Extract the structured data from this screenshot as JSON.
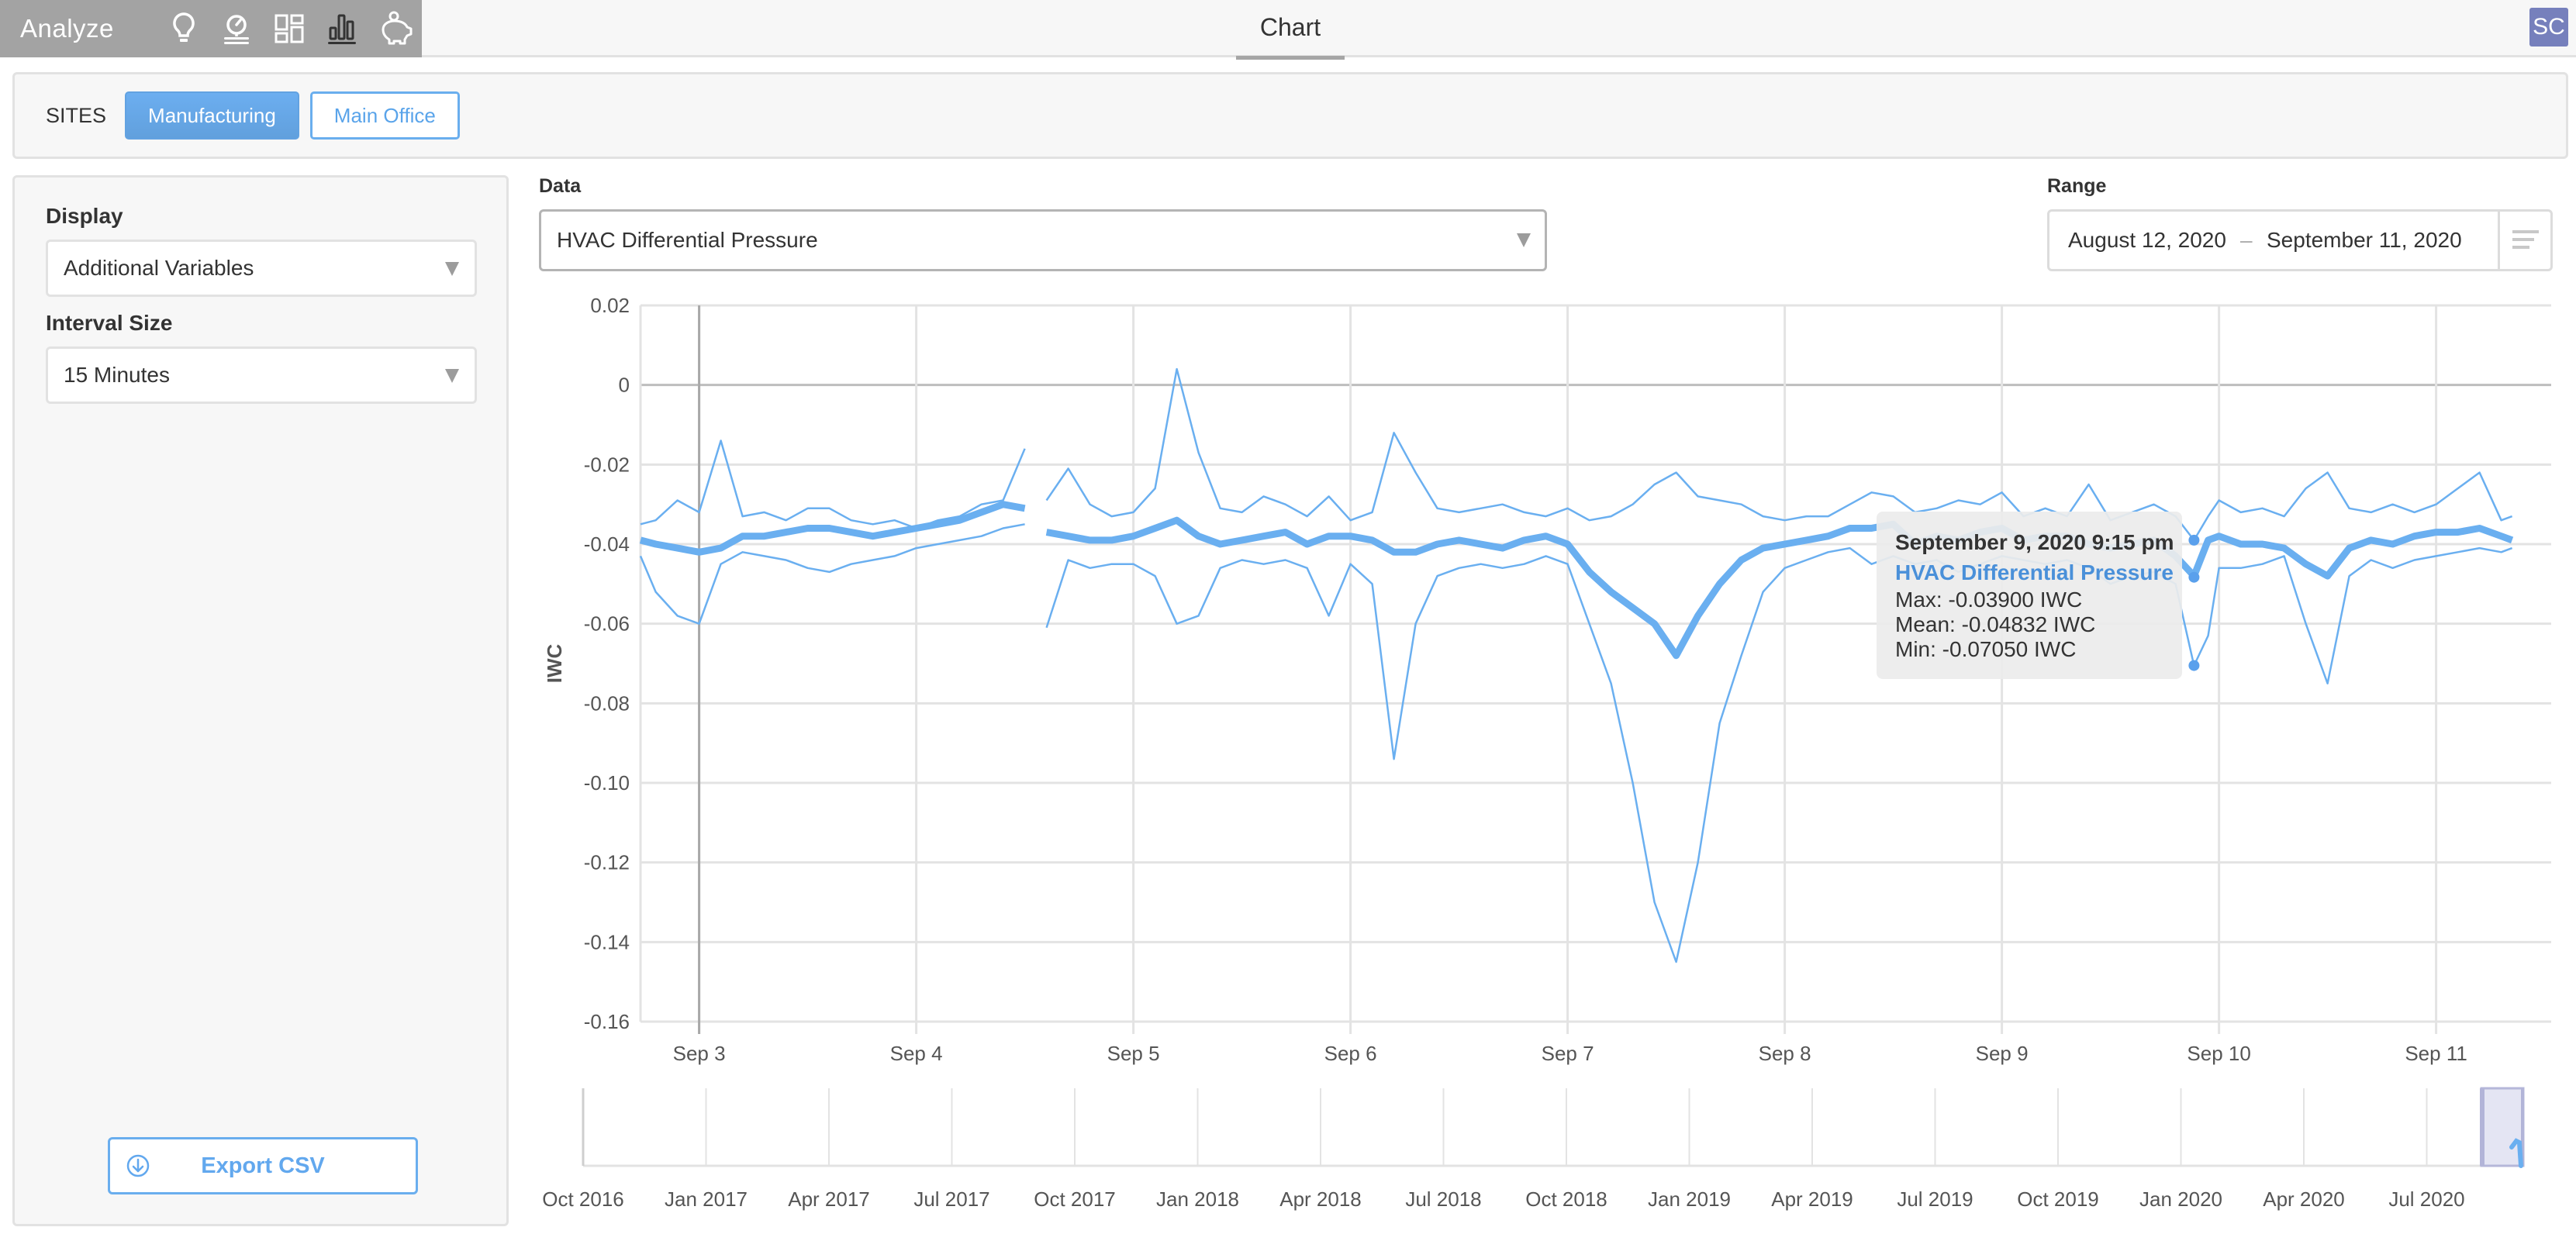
{
  "app": {
    "title": "Analyze",
    "nav_icons": [
      "lightbulb-icon",
      "gauge-icon",
      "dashboard-grid-icon",
      "bar-chart-icon",
      "piggy-bank-icon"
    ],
    "active_nav": "bar-chart-icon",
    "tab": "Chart",
    "user_initials": "SC"
  },
  "sites": {
    "label": "SITES",
    "items": [
      {
        "label": "Manufacturing",
        "active": true
      },
      {
        "label": "Main Office",
        "active": false
      }
    ]
  },
  "sidebar": {
    "display_label": "Display",
    "display_value": "Additional Variables",
    "interval_label": "Interval Size",
    "interval_value": "15 Minutes",
    "export_label": "Export CSV"
  },
  "controls": {
    "data_label": "Data",
    "data_value": "HVAC Differential Pressure",
    "range_label": "Range",
    "range_start": "August 12, 2020",
    "range_separator": "–",
    "range_end": "September 11, 2020"
  },
  "tooltip": {
    "date": "September 9, 2020 9:15 pm",
    "series": "HVAC Differential Pressure",
    "max": "Max: -0.03900 IWC",
    "mean": "Mean: -0.04832 IWC",
    "min": "Min: -0.07050 IWC"
  },
  "colors": {
    "accent": "#62a8ee",
    "series": "#6aaff0",
    "avatar": "#7680bc",
    "navigator_window": "#e4e5f3"
  },
  "chart_data": {
    "type": "line",
    "title": "",
    "ylabel": "IWC",
    "xlabel": "",
    "ylim": [
      -0.16,
      0.02
    ],
    "yticks": [
      "0.02",
      "0",
      "-0.02",
      "-0.04",
      "-0.06",
      "-0.08",
      "-0.10",
      "-0.12",
      "-0.14",
      "-0.16"
    ],
    "xticks": [
      "Sep 3",
      "Sep 4",
      "Sep 5",
      "Sep 6",
      "Sep 7",
      "Sep 8",
      "Sep 9",
      "Sep 10",
      "Sep 11"
    ],
    "x_unit": "days since Sep 3 00:00 (2020)",
    "xlim": [
      -0.27,
      8.53
    ],
    "crosshair_x": 0.0,
    "hover_x": 6.885,
    "hover_values": {
      "max": -0.039,
      "mean": -0.04832,
      "min": -0.0705
    },
    "x": [
      -0.27,
      -0.2,
      -0.1,
      0.0,
      0.1,
      0.2,
      0.3,
      0.4,
      0.5,
      0.6,
      0.7,
      0.8,
      0.9,
      1.0,
      1.1,
      1.2,
      1.3,
      1.4,
      1.5,
      1.55,
      1.6,
      1.7,
      1.8,
      1.9,
      2.0,
      2.1,
      2.2,
      2.3,
      2.4,
      2.5,
      2.6,
      2.7,
      2.8,
      2.9,
      3.0,
      3.1,
      3.2,
      3.3,
      3.4,
      3.5,
      3.6,
      3.7,
      3.8,
      3.9,
      4.0,
      4.1,
      4.2,
      4.3,
      4.4,
      4.5,
      4.6,
      4.7,
      4.8,
      4.9,
      5.0,
      5.1,
      5.2,
      5.3,
      5.4,
      5.5,
      5.6,
      5.7,
      5.8,
      5.9,
      6.0,
      6.1,
      6.2,
      6.3,
      6.4,
      6.5,
      6.6,
      6.7,
      6.8,
      6.885,
      6.95,
      7.0,
      7.1,
      7.2,
      7.3,
      7.4,
      7.5,
      7.6,
      7.7,
      7.8,
      7.9,
      8.0,
      8.1,
      8.2,
      8.3,
      8.35
    ],
    "series": [
      {
        "name": "Max",
        "values": [
          -0.035,
          -0.034,
          -0.029,
          -0.032,
          -0.014,
          -0.033,
          -0.032,
          -0.034,
          -0.031,
          -0.031,
          -0.034,
          -0.035,
          -0.034,
          -0.036,
          -0.034,
          -0.033,
          -0.03,
          -0.029,
          -0.016,
          null,
          -0.029,
          -0.021,
          -0.03,
          -0.033,
          -0.032,
          -0.026,
          0.004,
          -0.017,
          -0.031,
          -0.032,
          -0.028,
          -0.03,
          -0.033,
          -0.028,
          -0.034,
          -0.032,
          -0.012,
          -0.022,
          -0.031,
          -0.032,
          -0.031,
          -0.03,
          -0.032,
          -0.033,
          -0.031,
          -0.034,
          -0.033,
          -0.03,
          -0.025,
          -0.022,
          -0.028,
          -0.029,
          -0.03,
          -0.033,
          -0.034,
          -0.033,
          -0.033,
          -0.03,
          -0.027,
          -0.028,
          -0.032,
          -0.031,
          -0.029,
          -0.03,
          -0.027,
          -0.033,
          -0.031,
          -0.033,
          -0.025,
          -0.034,
          -0.032,
          -0.03,
          -0.033,
          -0.039,
          -0.033,
          -0.029,
          -0.032,
          -0.031,
          -0.033,
          -0.026,
          -0.022,
          -0.031,
          -0.032,
          -0.03,
          -0.032,
          -0.03,
          -0.026,
          -0.022,
          -0.034,
          -0.033
        ]
      },
      {
        "name": "Mean",
        "values": [
          -0.039,
          -0.04,
          -0.041,
          -0.042,
          -0.041,
          -0.038,
          -0.038,
          -0.037,
          -0.036,
          -0.036,
          -0.037,
          -0.038,
          -0.037,
          -0.036,
          -0.035,
          -0.034,
          -0.032,
          -0.03,
          -0.031,
          null,
          -0.037,
          -0.038,
          -0.039,
          -0.039,
          -0.038,
          -0.036,
          -0.034,
          -0.038,
          -0.04,
          -0.039,
          -0.038,
          -0.037,
          -0.04,
          -0.038,
          -0.038,
          -0.039,
          -0.042,
          -0.042,
          -0.04,
          -0.039,
          -0.04,
          -0.041,
          -0.039,
          -0.038,
          -0.04,
          -0.047,
          -0.052,
          -0.056,
          -0.06,
          -0.068,
          -0.058,
          -0.05,
          -0.044,
          -0.041,
          -0.04,
          -0.039,
          -0.038,
          -0.036,
          -0.036,
          -0.035,
          -0.04,
          -0.038,
          -0.039,
          -0.037,
          -0.036,
          -0.039,
          -0.038,
          -0.038,
          -0.04,
          -0.041,
          -0.04,
          -0.039,
          -0.043,
          -0.048,
          -0.039,
          -0.038,
          -0.04,
          -0.04,
          -0.041,
          -0.045,
          -0.048,
          -0.041,
          -0.039,
          -0.04,
          -0.038,
          -0.037,
          -0.037,
          -0.036,
          -0.038,
          -0.039
        ]
      },
      {
        "name": "Min",
        "values": [
          -0.043,
          -0.052,
          -0.058,
          -0.06,
          -0.045,
          -0.042,
          -0.043,
          -0.044,
          -0.046,
          -0.047,
          -0.045,
          -0.044,
          -0.043,
          -0.041,
          -0.04,
          -0.039,
          -0.038,
          -0.036,
          -0.035,
          null,
          -0.061,
          -0.044,
          -0.046,
          -0.045,
          -0.045,
          -0.048,
          -0.06,
          -0.058,
          -0.046,
          -0.044,
          -0.045,
          -0.044,
          -0.046,
          -0.058,
          -0.045,
          -0.05,
          -0.094,
          -0.06,
          -0.048,
          -0.046,
          -0.045,
          -0.046,
          -0.045,
          -0.043,
          -0.045,
          -0.06,
          -0.075,
          -0.1,
          -0.13,
          -0.145,
          -0.12,
          -0.085,
          -0.068,
          -0.052,
          -0.046,
          -0.044,
          -0.042,
          -0.041,
          -0.045,
          -0.043,
          -0.045,
          -0.044,
          -0.047,
          -0.045,
          -0.043,
          -0.044,
          -0.045,
          -0.044,
          -0.046,
          -0.05,
          -0.048,
          -0.047,
          -0.05,
          -0.0705,
          -0.063,
          -0.046,
          -0.046,
          -0.045,
          -0.043,
          -0.06,
          -0.075,
          -0.048,
          -0.044,
          -0.046,
          -0.044,
          -0.043,
          -0.042,
          -0.041,
          -0.042,
          -0.041
        ]
      }
    ],
    "navigator": {
      "xticks": [
        "Oct 2016",
        "Jan 2017",
        "Apr 2017",
        "Jul 2017",
        "Oct 2017",
        "Jan 2018",
        "Apr 2018",
        "Jul 2018",
        "Oct 2018",
        "Jan 2019",
        "Apr 2019",
        "Jul 2019",
        "Oct 2019",
        "Jan 2020",
        "Apr 2020",
        "Jul 2020"
      ],
      "selected_range": [
        "Aug 12, 2020",
        "Sep 11, 2020"
      ]
    },
    "grid": true,
    "legend": "none"
  }
}
